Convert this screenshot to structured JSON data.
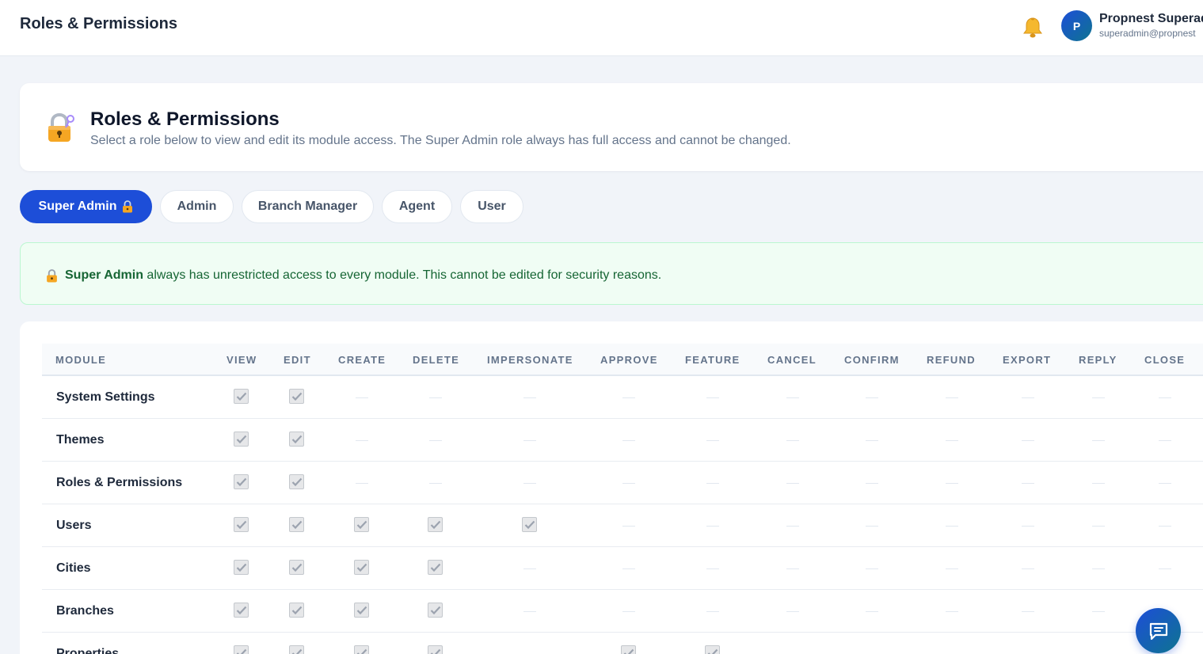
{
  "topbar": {
    "title": "Roles & Permissions",
    "user": {
      "initial": "P",
      "name": "Propnest Superadmin",
      "email": "superadmin@propnest"
    }
  },
  "header": {
    "title": "Roles & Permissions",
    "description": "Select a role below to view and edit its module access. The Super Admin role always has full access and cannot be changed."
  },
  "roles": [
    {
      "label": "Super Admin",
      "active": true,
      "locked": true
    },
    {
      "label": "Admin",
      "active": false
    },
    {
      "label": "Branch Manager",
      "active": false
    },
    {
      "label": "Agent",
      "active": false
    },
    {
      "label": "User",
      "active": false
    }
  ],
  "notice": {
    "role": "Super Admin",
    "text": " always has unrestricted access to every module. This cannot be edited for security reasons."
  },
  "columns": [
    "MODULE",
    "VIEW",
    "EDIT",
    "CREATE",
    "DELETE",
    "IMPERSONATE",
    "APPROVE",
    "FEATURE",
    "CANCEL",
    "CONFIRM",
    "REFUND",
    "EXPORT",
    "REPLY",
    "CLOSE"
  ],
  "rows": [
    {
      "module": "System Settings",
      "perms": [
        1,
        1,
        0,
        0,
        0,
        0,
        0,
        0,
        0,
        0,
        0,
        0,
        0
      ]
    },
    {
      "module": "Themes",
      "perms": [
        1,
        1,
        0,
        0,
        0,
        0,
        0,
        0,
        0,
        0,
        0,
        0,
        0
      ]
    },
    {
      "module": "Roles & Permissions",
      "perms": [
        1,
        1,
        0,
        0,
        0,
        0,
        0,
        0,
        0,
        0,
        0,
        0,
        0
      ]
    },
    {
      "module": "Users",
      "perms": [
        1,
        1,
        1,
        1,
        1,
        0,
        0,
        0,
        0,
        0,
        0,
        0,
        0
      ]
    },
    {
      "module": "Cities",
      "perms": [
        1,
        1,
        1,
        1,
        0,
        0,
        0,
        0,
        0,
        0,
        0,
        0,
        0
      ]
    },
    {
      "module": "Branches",
      "perms": [
        1,
        1,
        1,
        1,
        0,
        0,
        0,
        0,
        0,
        0,
        0,
        0,
        0
      ]
    },
    {
      "module": "Properties",
      "perms": [
        1,
        1,
        1,
        1,
        0,
        1,
        1,
        0,
        0,
        0,
        0,
        0,
        0
      ]
    }
  ],
  "icons": {
    "bell": "bell-icon",
    "lock": "lock-icon",
    "chat": "chat-icon"
  },
  "colors": {
    "primary": "#1d4ed8",
    "notice_bg": "#f0fdf4",
    "notice_text": "#166534"
  }
}
